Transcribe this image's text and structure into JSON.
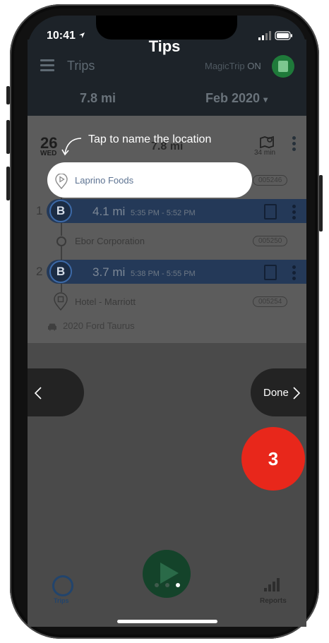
{
  "status": {
    "time": "10:41"
  },
  "overlay": {
    "title": "Tips",
    "hint": "Tap to name the location",
    "done_label": "Done",
    "step_number": "3"
  },
  "header": {
    "title": "Trips",
    "magictrip_label": "MagicTrip",
    "magictrip_state": "ON",
    "total_distance": "7.8 mi",
    "period": "Feb 2020",
    "period_arrow": "▾"
  },
  "day": {
    "date_number": "26",
    "weekday": "WED",
    "distance": "7.8 mi",
    "duration": "34 min"
  },
  "stops": [
    {
      "name": "Laprino Foods",
      "id": "005246"
    },
    {
      "name": "Ebor Corporation",
      "id": "005250"
    },
    {
      "name": "Hotel - Marriott",
      "id": "005254"
    }
  ],
  "trips": [
    {
      "number": "1",
      "badge": "B",
      "distance": "4.1 mi",
      "time": "5:35 PM - 5:52 PM"
    },
    {
      "number": "2",
      "badge": "B",
      "distance": "3.7 mi",
      "time": "5:38 PM - 5:55 PM"
    }
  ],
  "vehicle": "2020 Ford Taurus",
  "tabs": {
    "trips": "Trips",
    "reports": "Reports"
  },
  "colors": {
    "accent": "#243958",
    "step": "#e8271b",
    "highlight": "#ffffff"
  }
}
